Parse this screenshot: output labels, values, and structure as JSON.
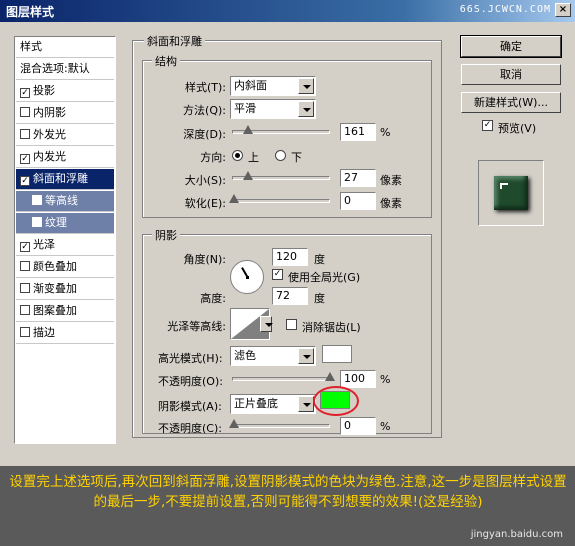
{
  "window": {
    "title": "图层样式",
    "watermark": "66S.JCWCN.COM",
    "close": "×"
  },
  "left_list": {
    "header": "样式",
    "blend": "混合选项:默认",
    "items": [
      {
        "label": "投影",
        "checked": true
      },
      {
        "label": "内阴影",
        "checked": false
      },
      {
        "label": "外发光",
        "checked": false
      },
      {
        "label": "内发光",
        "checked": true
      },
      {
        "label": "斜面和浮雕",
        "checked": true,
        "selected": true
      },
      {
        "label": "等高线",
        "checked": false,
        "sub": true
      },
      {
        "label": "纹理",
        "checked": false,
        "sub": true
      },
      {
        "label": "光泽",
        "checked": true
      },
      {
        "label": "颜色叠加",
        "checked": false
      },
      {
        "label": "渐变叠加",
        "checked": false
      },
      {
        "label": "图案叠加",
        "checked": false
      },
      {
        "label": "描边",
        "checked": false
      }
    ]
  },
  "bevel": {
    "title": "斜面和浮雕",
    "structure": {
      "title": "结构",
      "style_label": "样式(T):",
      "style_value": "内斜面",
      "technique_label": "方法(Q):",
      "technique_value": "平滑",
      "depth_label": "深度(D):",
      "depth_value": "161",
      "depth_unit": "%",
      "direction_label": "方向:",
      "dir_up": "上",
      "dir_down": "下",
      "size_label": "大小(S):",
      "size_value": "27",
      "size_unit": "像素",
      "soften_label": "软化(E):",
      "soften_value": "0",
      "soften_unit": "像素"
    },
    "shading": {
      "title": "阴影",
      "angle_label": "角度(N):",
      "angle_value": "120",
      "angle_unit": "度",
      "global_light_label": "使用全局光(G)",
      "altitude_label": "高度:",
      "altitude_value": "72",
      "altitude_unit": "度",
      "gloss_label": "光泽等高线:",
      "antialias_label": "消除锯齿(L)",
      "highlight_label": "高光模式(H):",
      "highlight_value": "滤色",
      "highlight_opacity_label": "不透明度(O):",
      "highlight_opacity_value": "100",
      "highlight_opacity_unit": "%",
      "shadow_label": "阴影模式(A):",
      "shadow_value": "正片叠底",
      "shadow_opacity_label": "不透明度(C):",
      "shadow_opacity_value": "0",
      "shadow_opacity_unit": "%"
    }
  },
  "buttons": {
    "ok": "确定",
    "cancel": "取消",
    "new_style": "新建样式(W)...",
    "preview": "预览(V)"
  },
  "colors": {
    "highlight_swatch": "#ffffff",
    "shadow_swatch": "#00ff00",
    "annotation": "#e0202a"
  },
  "caption": {
    "text": "设置完上述选项后,再次回到斜面浮雕,设置阴影模式的色块为绿色.注意,这一步是图层样式设置的最后一步,不要提前设置,否则可能得不到想要的效果!(这是经验)",
    "site": "jingyan.baidu.com"
  }
}
